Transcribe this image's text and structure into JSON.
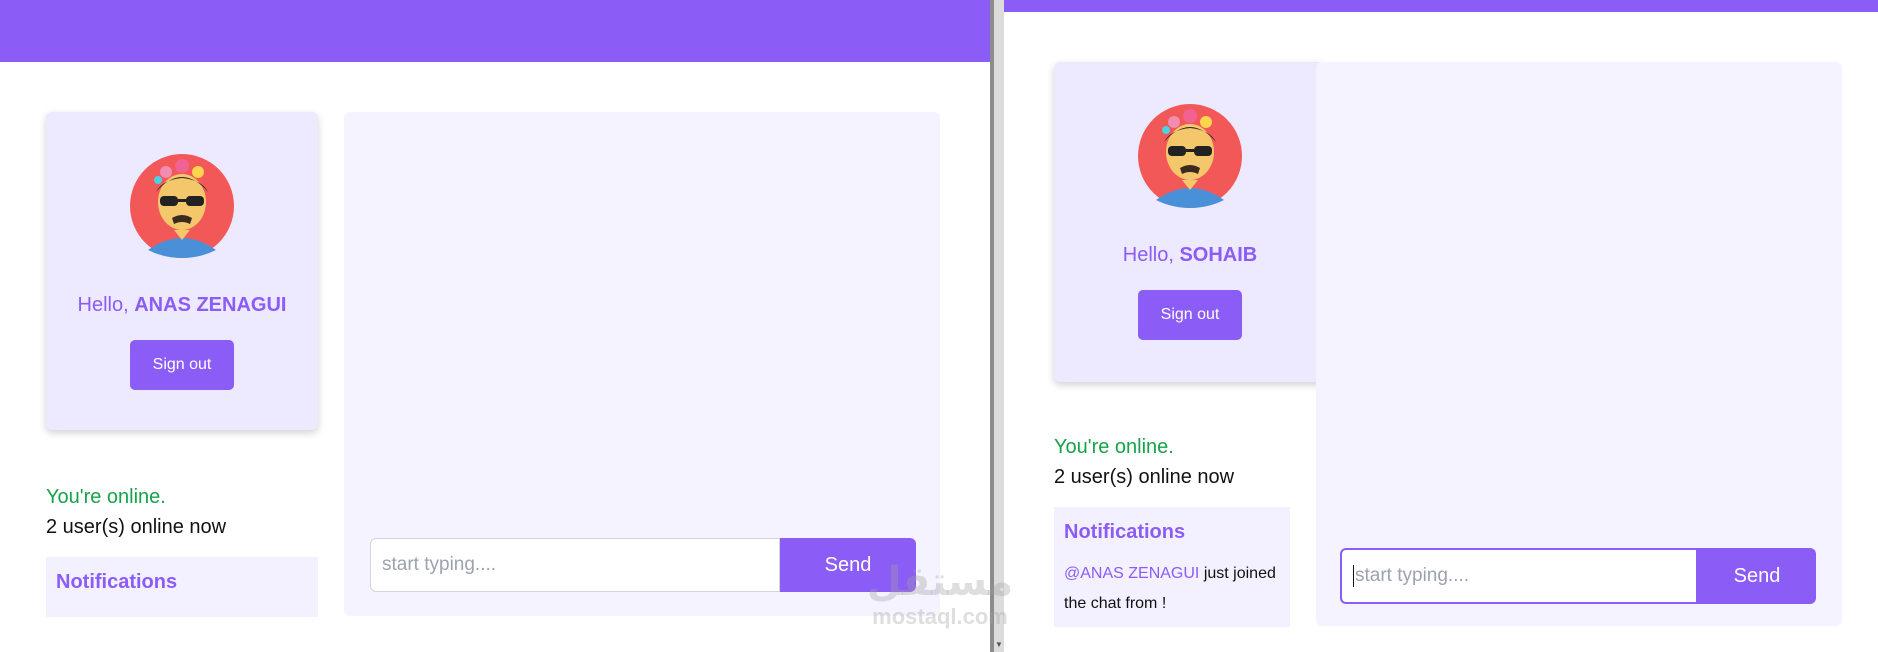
{
  "colors": {
    "accent": "#8b5cf6",
    "card": "#ede9fe",
    "panel": "#f5f3ff",
    "online": "#16a34a"
  },
  "left_window": {
    "user": {
      "greeting": "Hello,",
      "name": "ANAS ZENAGUI",
      "avatar_icon": "user-avatar-icon"
    },
    "sign_out_label": "Sign out",
    "status": "You're online.",
    "online_count": "2 user(s) online now",
    "notifications_title": "Notifications",
    "chat": {
      "placeholder": "start typing....",
      "send_label": "Send"
    }
  },
  "right_window": {
    "user": {
      "greeting": "Hello,",
      "name": "SOHAIB",
      "avatar_icon": "user-avatar-icon"
    },
    "sign_out_label": "Sign out",
    "status": "You're online.",
    "online_count": "2 user(s) online now",
    "notifications_title": "Notifications",
    "notification": {
      "mention": "@ANAS ZENAGUI",
      "text": "just joined the chat from !"
    },
    "chat": {
      "placeholder": "start typing....",
      "send_label": "Send"
    }
  },
  "watermark": {
    "arabic": "مستقل",
    "latin": "mostaql.com"
  }
}
